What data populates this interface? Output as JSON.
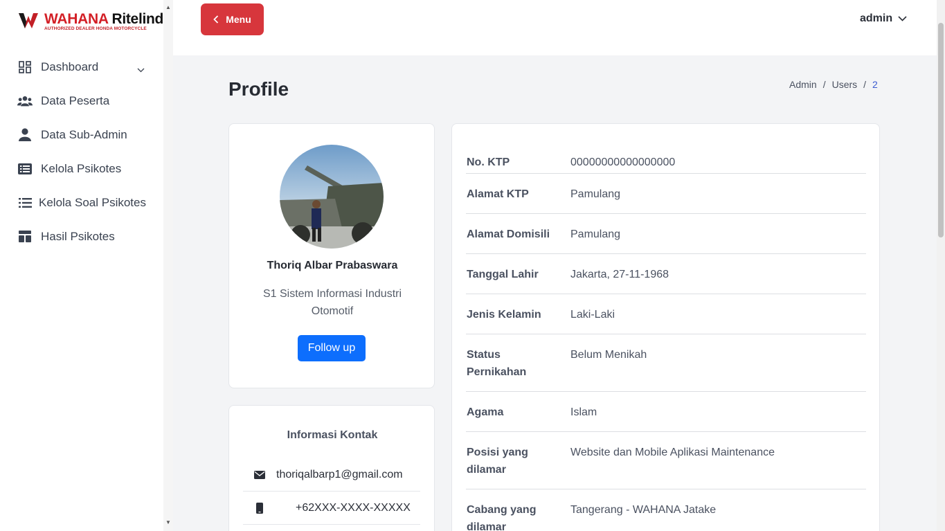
{
  "brand": {
    "name_a": "WAHANA",
    "name_b": "Ritelindo",
    "tagline": "AUTHORIZED DEALER HONDA MOTORCYCLE",
    "color": "#d32027"
  },
  "sidebar": {
    "items": [
      {
        "label": "Dashboard",
        "icon": "dashboard-grid-icon"
      },
      {
        "label": "Data Peserta",
        "icon": "users-icon"
      },
      {
        "label": "Data Sub-Admin",
        "icon": "user-icon"
      },
      {
        "label": "Kelola Psikotes",
        "icon": "list-alt-icon"
      },
      {
        "label": "Kelola Soal Psikotes",
        "icon": "list-icon"
      },
      {
        "label": "Hasil Psikotes",
        "icon": "layout-icon"
      }
    ]
  },
  "topbar": {
    "menu_label": "Menu",
    "user_label": "admin",
    "menu_color": "#d7363c"
  },
  "page": {
    "title": "Profile",
    "breadcrumb": [
      "Admin",
      "Users",
      "2"
    ]
  },
  "profile": {
    "name": "Thoriq Albar Prabaswara",
    "major": "S1 Sistem Informasi Industri Otomotif",
    "follow_label": "Follow up"
  },
  "contact": {
    "title": "Informasi Kontak",
    "email": "thoriqalbarp1@gmail.com",
    "phone": "+62XXX-XXXX-XXXXX"
  },
  "details": [
    {
      "label": "No. KTP",
      "value": "00000000000000000"
    },
    {
      "label": "Alamat KTP",
      "value": "Pamulang"
    },
    {
      "label": "Alamat Domisili",
      "value": "Pamulang"
    },
    {
      "label": "Tanggal Lahir",
      "value": "Jakarta, 27-11-1968"
    },
    {
      "label": "Jenis Kelamin",
      "value": "Laki-Laki"
    },
    {
      "label": "Status Pernikahan",
      "value": "Belum Menikah"
    },
    {
      "label": "Agama",
      "value": "Islam"
    },
    {
      "label": "Posisi yang dilamar",
      "value": "Website dan Mobile Aplikasi Maintenance"
    },
    {
      "label": "Cabang yang dilamar",
      "value": "Tangerang - WAHANA Jatake"
    }
  ]
}
